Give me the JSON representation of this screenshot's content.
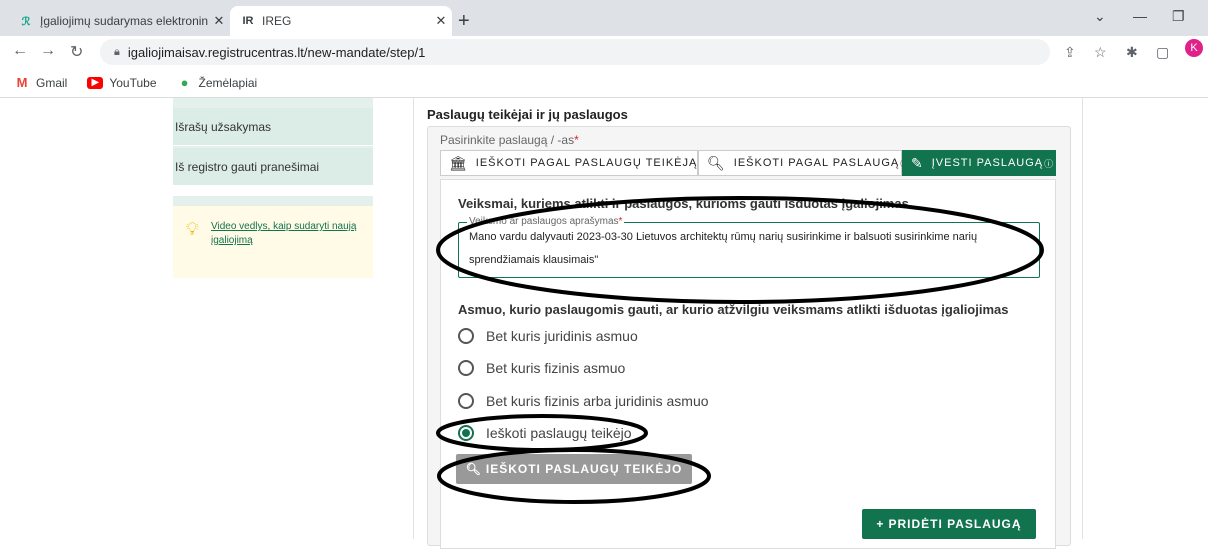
{
  "browser": {
    "tabs": [
      {
        "title": "Įgaliojimų sudarymas elektronini",
        "close": "✕"
      },
      {
        "favicon": "IR",
        "title": "IREG",
        "close": "✕"
      }
    ],
    "new_tab": "+",
    "url": "igaliojimaisav.registrucentras.lt/new-mandate/step/1",
    "avatar_letter": "K",
    "bookmarks": [
      "Gmail",
      "YouTube",
      "Žemėlapiai"
    ]
  },
  "sidebar": {
    "items": [
      "Išrašų užsakymas",
      "Iš registro gauti pranešimai"
    ],
    "video_link": "Video vedlys, kaip sudaryti naują įgaliojimą"
  },
  "main": {
    "section_title": "Paslaugų teikėjai ir jų paslaugos",
    "select_label": "Pasirinkite paslaugą / -as",
    "required_mark": "*",
    "tabs": [
      {
        "label": "IEŠKOTI PAGAL PASLAUGŲ TEIKĖJĄ",
        "info": "ⓘ"
      },
      {
        "label": "IEŠKOTI PAGAL PASLAUGĄ",
        "info": "ⓘ"
      },
      {
        "label": "ĮVESTI PASLAUGĄ",
        "info": "ⓘ"
      }
    ],
    "actions_heading": "Veiksmai, kuriems atlikti ir paslaugos, kurioms gauti išduotas įgaliojimas",
    "description_label": "Veiksmo ar paslaugos aprašymas",
    "description_value": "Mano vardu dalyvauti  2023-03-30 Lietuvos architektų rūmų narių susirinkime ir balsuoti susirinkime narių sprendžiamais klausimais\"",
    "person_heading": "Asmuo, kurio paslaugomis gauti, ar kurio atžvilgiu veiksmams atlikti išduotas įgaliojimas",
    "radio_options": [
      "Bet kuris juridinis asmuo",
      "Bet kuris fizinis asmuo",
      "Bet kuris fizinis arba juridinis asmuo",
      "Ieškoti paslaugų teikėjo"
    ],
    "selected_option": 3,
    "search_button": "IEŠKOTI PASLAUGŲ TEIKĖJO",
    "add_button": "PRIDĖTI PASLAUGĄ"
  }
}
